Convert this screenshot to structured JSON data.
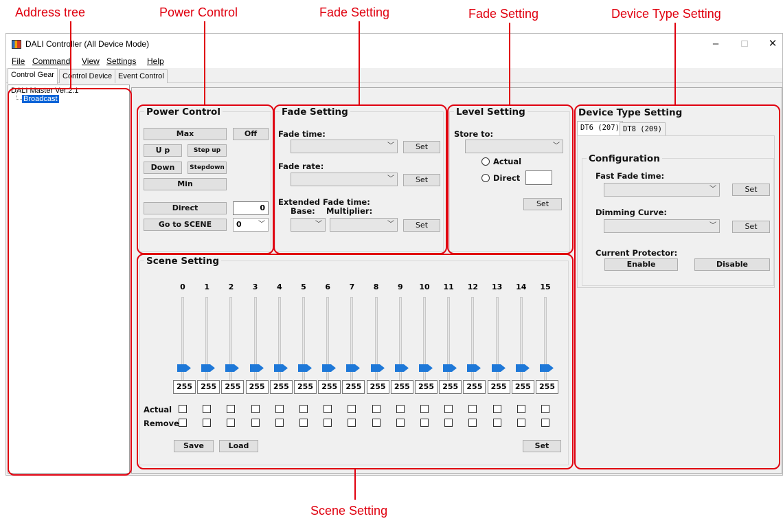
{
  "callouts": {
    "address_tree": "Address tree",
    "power_control": "Power Control",
    "fade_setting_1": "Fade Setting",
    "fade_setting_2": "Fade Setting",
    "device_type_setting": "Device Type Setting",
    "scene_setting": "Scene Setting"
  },
  "window": {
    "title": "DALI Controller (All Device Mode)",
    "minimize": "–",
    "maximize": "□",
    "close": "✕"
  },
  "menu": [
    "File",
    "Command",
    "View",
    "Settings",
    "Help"
  ],
  "tabs": [
    "Control Gear",
    "Control Device",
    "Event Control"
  ],
  "tree": {
    "root": "DALI Master Ver.2.1",
    "node": "Broadcast"
  },
  "power": {
    "title": "Power Control",
    "max": "Max",
    "off": "Off",
    "up": "U p",
    "step_up": "Step up",
    "down": "Down",
    "step_down": "Stepdown",
    "min": "Min",
    "direct": "Direct",
    "direct_value": "0",
    "go_to_scene": "Go to SCENE",
    "scene_value": "0"
  },
  "fade": {
    "title": "Fade Setting",
    "fade_time": "Fade time:",
    "fade_rate": "Fade rate:",
    "extended": "Extended Fade time:",
    "base": "Base:",
    "multiplier": "Multiplier:",
    "set": "Set"
  },
  "level": {
    "title": "Level Setting",
    "store_to": "Store to:",
    "actual": "Actual",
    "direct": "Direct",
    "set": "Set"
  },
  "device": {
    "title": "Device Type Setting",
    "tab_dt6": "DT6 (207)",
    "tab_dt8": "DT8 (209)",
    "config": "Configuration",
    "fast_fade": "Fast Fade time:",
    "dimming_curve": "Dimming Curve:",
    "current_protector": "Current Protector:",
    "enable": "Enable",
    "disable": "Disable",
    "set": "Set"
  },
  "scene": {
    "title": "Scene Setting",
    "numbers": [
      "0",
      "1",
      "2",
      "3",
      "4",
      "5",
      "6",
      "7",
      "8",
      "9",
      "10",
      "11",
      "12",
      "13",
      "14",
      "15"
    ],
    "values": [
      "255",
      "255",
      "255",
      "255",
      "255",
      "255",
      "255",
      "255",
      "255",
      "255",
      "255",
      "255",
      "255",
      "255",
      "255",
      "255"
    ],
    "actual": "Actual",
    "remove": "Remove",
    "save": "Save",
    "load": "Load",
    "set": "Set"
  },
  "colors": {
    "annotation": "#e0000f",
    "selection": "#0a64d8",
    "slider_thumb": "#1e78d8"
  }
}
